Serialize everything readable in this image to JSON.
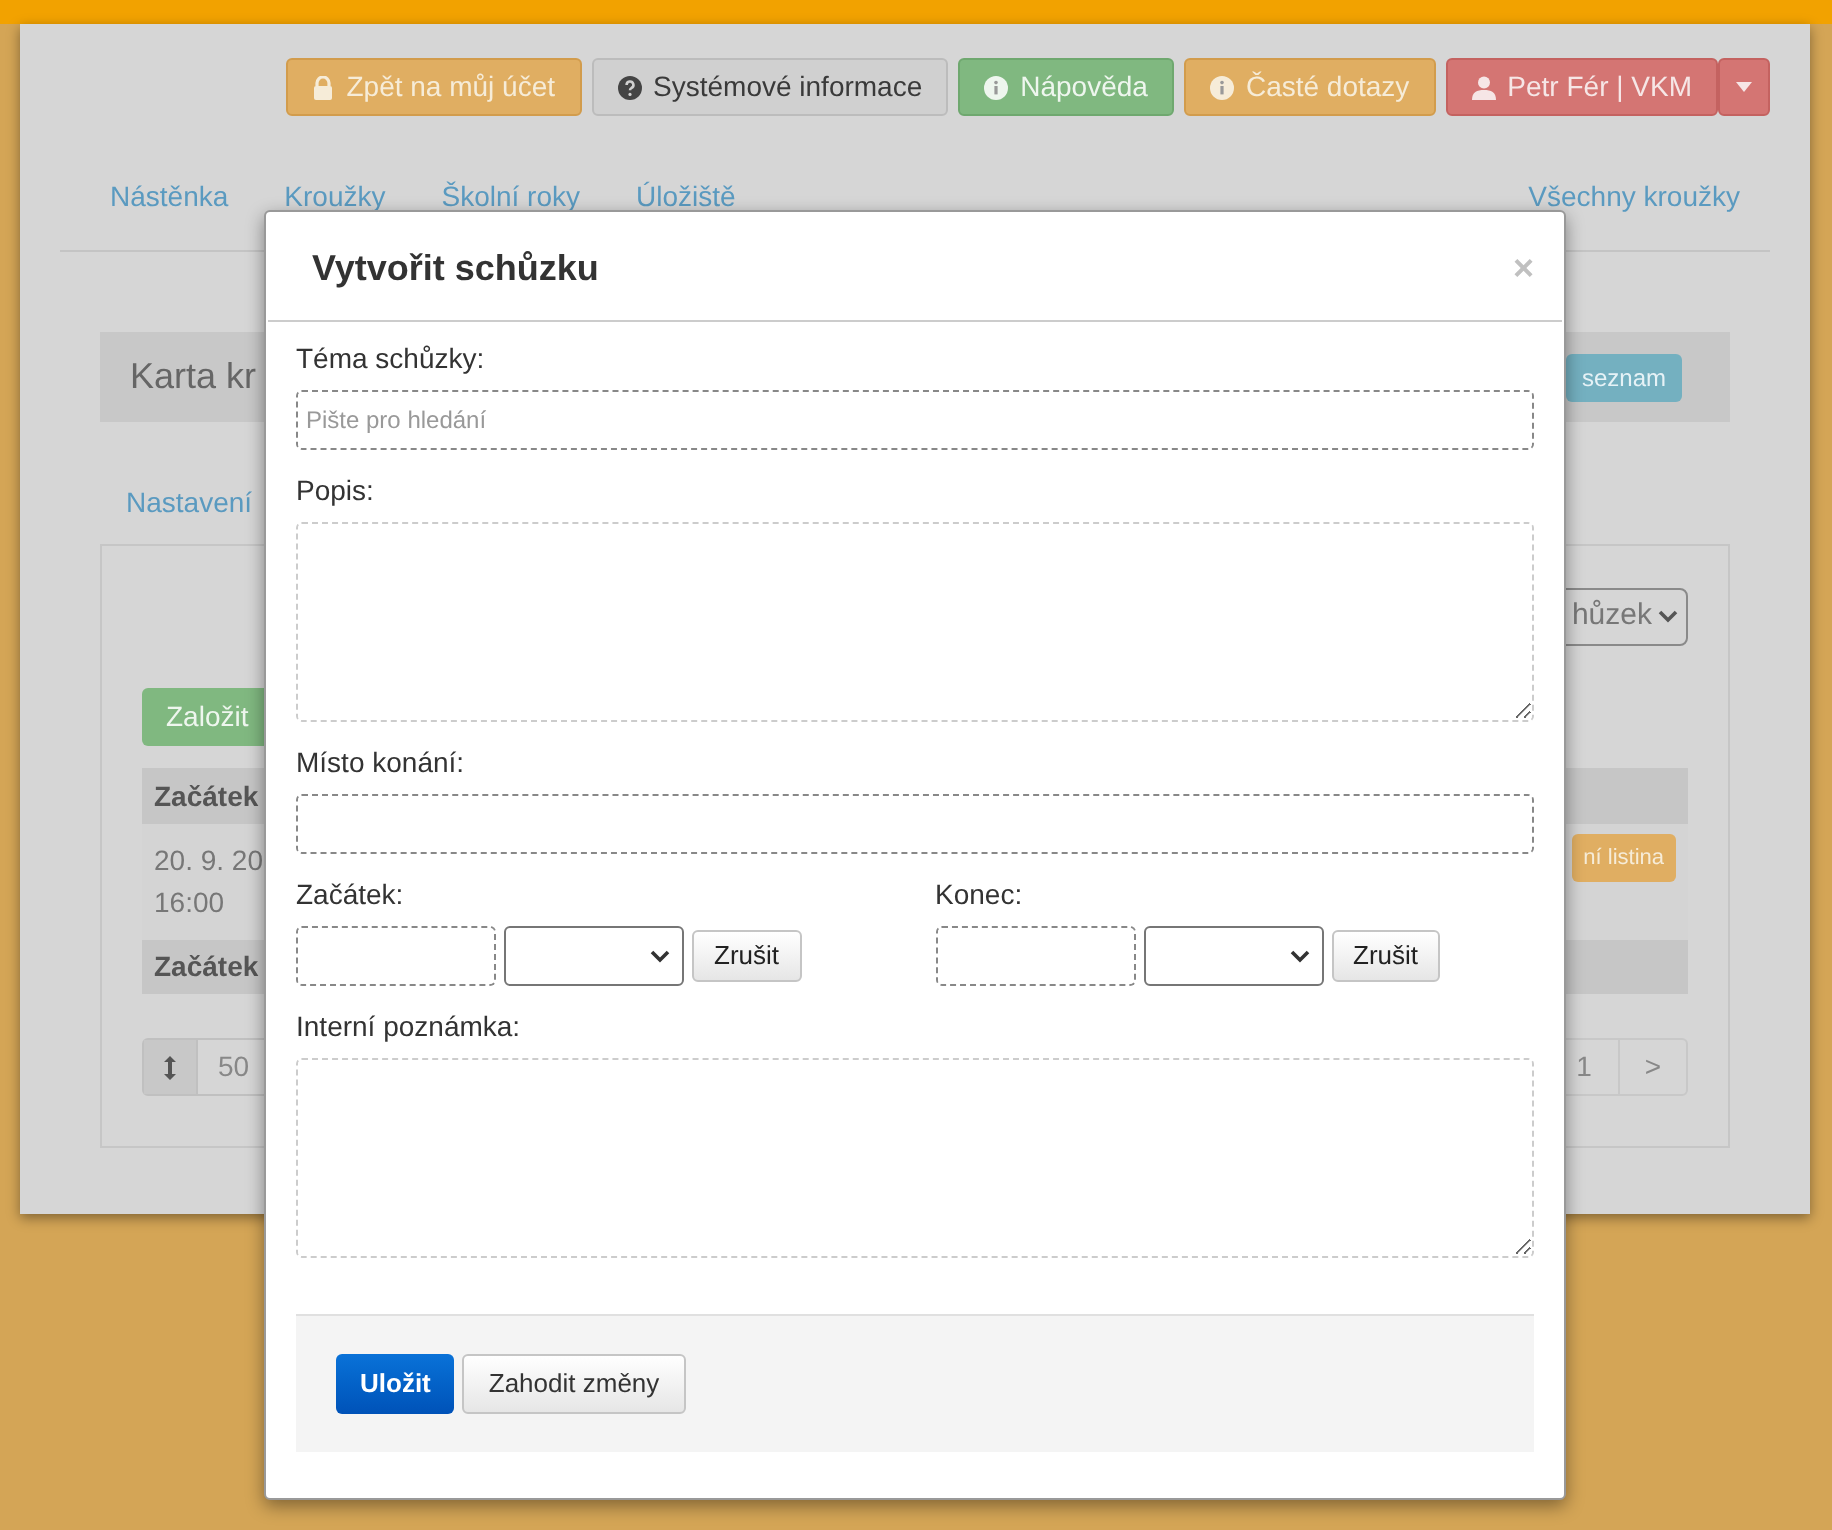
{
  "top_buttons": [
    {
      "label": "Zpět na můj účet",
      "kind": "warning"
    },
    {
      "label": "Systémové informace",
      "kind": "default"
    },
    {
      "label": "Nápověda",
      "kind": "success"
    },
    {
      "label": "Časté dotazy",
      "kind": "warning"
    },
    {
      "label": "Petr Fér | VKM",
      "kind": "danger"
    }
  ],
  "nav": {
    "items": [
      "Nástěnka",
      "Kroužky",
      "Školní roky",
      "Úložiště"
    ],
    "right": "Všechny kroužky"
  },
  "card_header": {
    "title": "Karta kr",
    "button": "seznam"
  },
  "tabs": [
    "Nastavení"
  ],
  "panel": {
    "select": "hůzek",
    "create_button": "Založit",
    "table": {
      "header": "Začátek",
      "row_lines": [
        "20. 9. 20",
        "16:00"
      ],
      "row_button": "ní listina",
      "footer": "Začátek"
    },
    "pagination": {
      "page_size": "50",
      "pages": [
        "1",
        ">"
      ]
    }
  },
  "modal": {
    "title": "Vytvořit schůzku",
    "close": "×",
    "fields": [
      {
        "kind": "text",
        "label": "Téma schůzky:",
        "placeholder": "Pište pro hledání"
      },
      {
        "kind": "textarea",
        "label": "Popis:"
      },
      {
        "kind": "text",
        "label": "Místo konání:"
      },
      {
        "kind": "datetime",
        "items": [
          {
            "label": "Začátek:",
            "button": "Zrušit"
          },
          {
            "label": "Konec:",
            "button": "Zrušit"
          }
        ]
      },
      {
        "kind": "textarea",
        "label": "Interní poznámka:"
      }
    ],
    "buttons": [
      {
        "label": "Uložit",
        "kind": "primary"
      },
      {
        "label": "Zahodit změny",
        "kind": "default"
      }
    ]
  }
}
